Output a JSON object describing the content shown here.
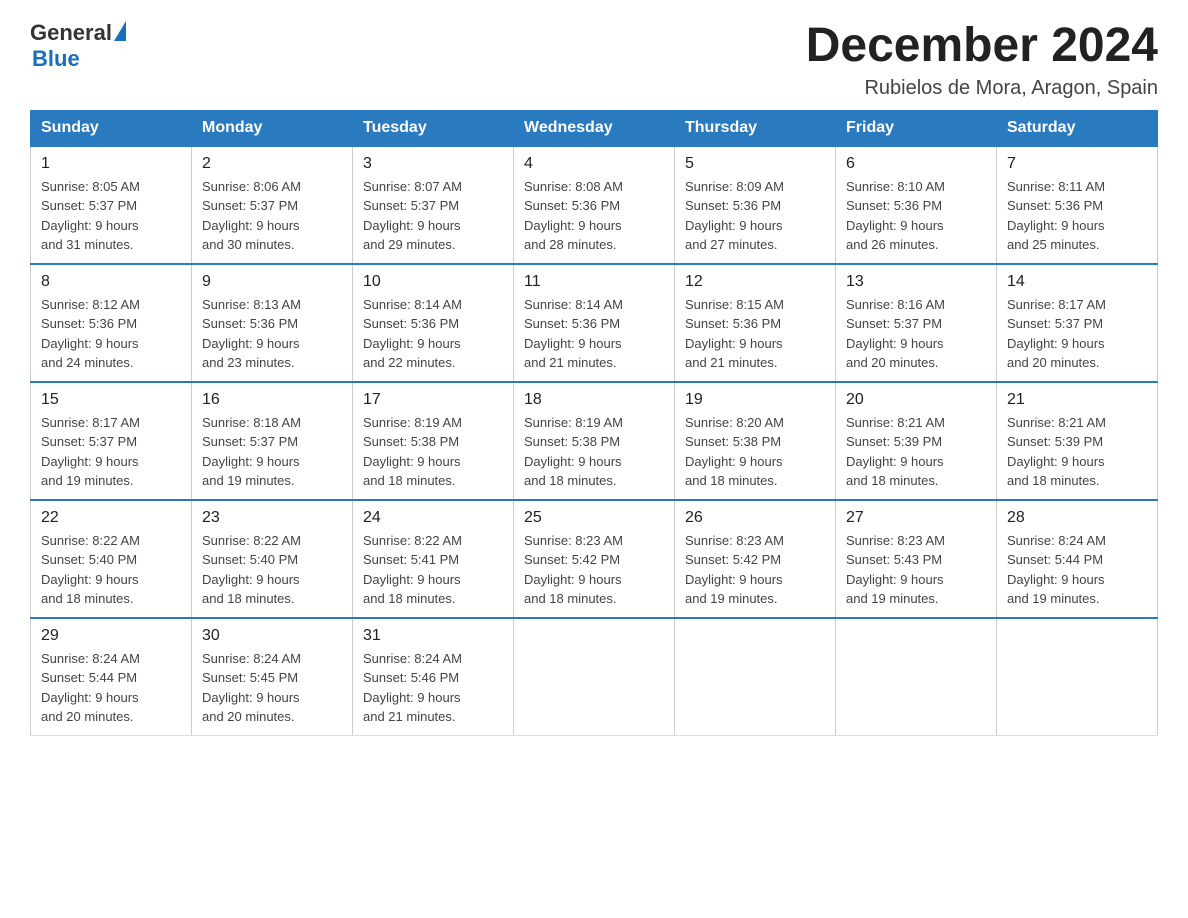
{
  "logo": {
    "general": "General",
    "blue": "Blue"
  },
  "header": {
    "month": "December 2024",
    "location": "Rubielos de Mora, Aragon, Spain"
  },
  "weekdays": [
    "Sunday",
    "Monday",
    "Tuesday",
    "Wednesday",
    "Thursday",
    "Friday",
    "Saturday"
  ],
  "weeks": [
    [
      {
        "day": "1",
        "sunrise": "8:05 AM",
        "sunset": "5:37 PM",
        "daylight": "9 hours and 31 minutes."
      },
      {
        "day": "2",
        "sunrise": "8:06 AM",
        "sunset": "5:37 PM",
        "daylight": "9 hours and 30 minutes."
      },
      {
        "day": "3",
        "sunrise": "8:07 AM",
        "sunset": "5:37 PM",
        "daylight": "9 hours and 29 minutes."
      },
      {
        "day": "4",
        "sunrise": "8:08 AM",
        "sunset": "5:36 PM",
        "daylight": "9 hours and 28 minutes."
      },
      {
        "day": "5",
        "sunrise": "8:09 AM",
        "sunset": "5:36 PM",
        "daylight": "9 hours and 27 minutes."
      },
      {
        "day": "6",
        "sunrise": "8:10 AM",
        "sunset": "5:36 PM",
        "daylight": "9 hours and 26 minutes."
      },
      {
        "day": "7",
        "sunrise": "8:11 AM",
        "sunset": "5:36 PM",
        "daylight": "9 hours and 25 minutes."
      }
    ],
    [
      {
        "day": "8",
        "sunrise": "8:12 AM",
        "sunset": "5:36 PM",
        "daylight": "9 hours and 24 minutes."
      },
      {
        "day": "9",
        "sunrise": "8:13 AM",
        "sunset": "5:36 PM",
        "daylight": "9 hours and 23 minutes."
      },
      {
        "day": "10",
        "sunrise": "8:14 AM",
        "sunset": "5:36 PM",
        "daylight": "9 hours and 22 minutes."
      },
      {
        "day": "11",
        "sunrise": "8:14 AM",
        "sunset": "5:36 PM",
        "daylight": "9 hours and 21 minutes."
      },
      {
        "day": "12",
        "sunrise": "8:15 AM",
        "sunset": "5:36 PM",
        "daylight": "9 hours and 21 minutes."
      },
      {
        "day": "13",
        "sunrise": "8:16 AM",
        "sunset": "5:37 PM",
        "daylight": "9 hours and 20 minutes."
      },
      {
        "day": "14",
        "sunrise": "8:17 AM",
        "sunset": "5:37 PM",
        "daylight": "9 hours and 20 minutes."
      }
    ],
    [
      {
        "day": "15",
        "sunrise": "8:17 AM",
        "sunset": "5:37 PM",
        "daylight": "9 hours and 19 minutes."
      },
      {
        "day": "16",
        "sunrise": "8:18 AM",
        "sunset": "5:37 PM",
        "daylight": "9 hours and 19 minutes."
      },
      {
        "day": "17",
        "sunrise": "8:19 AM",
        "sunset": "5:38 PM",
        "daylight": "9 hours and 18 minutes."
      },
      {
        "day": "18",
        "sunrise": "8:19 AM",
        "sunset": "5:38 PM",
        "daylight": "9 hours and 18 minutes."
      },
      {
        "day": "19",
        "sunrise": "8:20 AM",
        "sunset": "5:38 PM",
        "daylight": "9 hours and 18 minutes."
      },
      {
        "day": "20",
        "sunrise": "8:21 AM",
        "sunset": "5:39 PM",
        "daylight": "9 hours and 18 minutes."
      },
      {
        "day": "21",
        "sunrise": "8:21 AM",
        "sunset": "5:39 PM",
        "daylight": "9 hours and 18 minutes."
      }
    ],
    [
      {
        "day": "22",
        "sunrise": "8:22 AM",
        "sunset": "5:40 PM",
        "daylight": "9 hours and 18 minutes."
      },
      {
        "day": "23",
        "sunrise": "8:22 AM",
        "sunset": "5:40 PM",
        "daylight": "9 hours and 18 minutes."
      },
      {
        "day": "24",
        "sunrise": "8:22 AM",
        "sunset": "5:41 PM",
        "daylight": "9 hours and 18 minutes."
      },
      {
        "day": "25",
        "sunrise": "8:23 AM",
        "sunset": "5:42 PM",
        "daylight": "9 hours and 18 minutes."
      },
      {
        "day": "26",
        "sunrise": "8:23 AM",
        "sunset": "5:42 PM",
        "daylight": "9 hours and 19 minutes."
      },
      {
        "day": "27",
        "sunrise": "8:23 AM",
        "sunset": "5:43 PM",
        "daylight": "9 hours and 19 minutes."
      },
      {
        "day": "28",
        "sunrise": "8:24 AM",
        "sunset": "5:44 PM",
        "daylight": "9 hours and 19 minutes."
      }
    ],
    [
      {
        "day": "29",
        "sunrise": "8:24 AM",
        "sunset": "5:44 PM",
        "daylight": "9 hours and 20 minutes."
      },
      {
        "day": "30",
        "sunrise": "8:24 AM",
        "sunset": "5:45 PM",
        "daylight": "9 hours and 20 minutes."
      },
      {
        "day": "31",
        "sunrise": "8:24 AM",
        "sunset": "5:46 PM",
        "daylight": "9 hours and 21 minutes."
      },
      null,
      null,
      null,
      null
    ]
  ],
  "labels": {
    "sunrise": "Sunrise:",
    "sunset": "Sunset:",
    "daylight": "Daylight:"
  }
}
